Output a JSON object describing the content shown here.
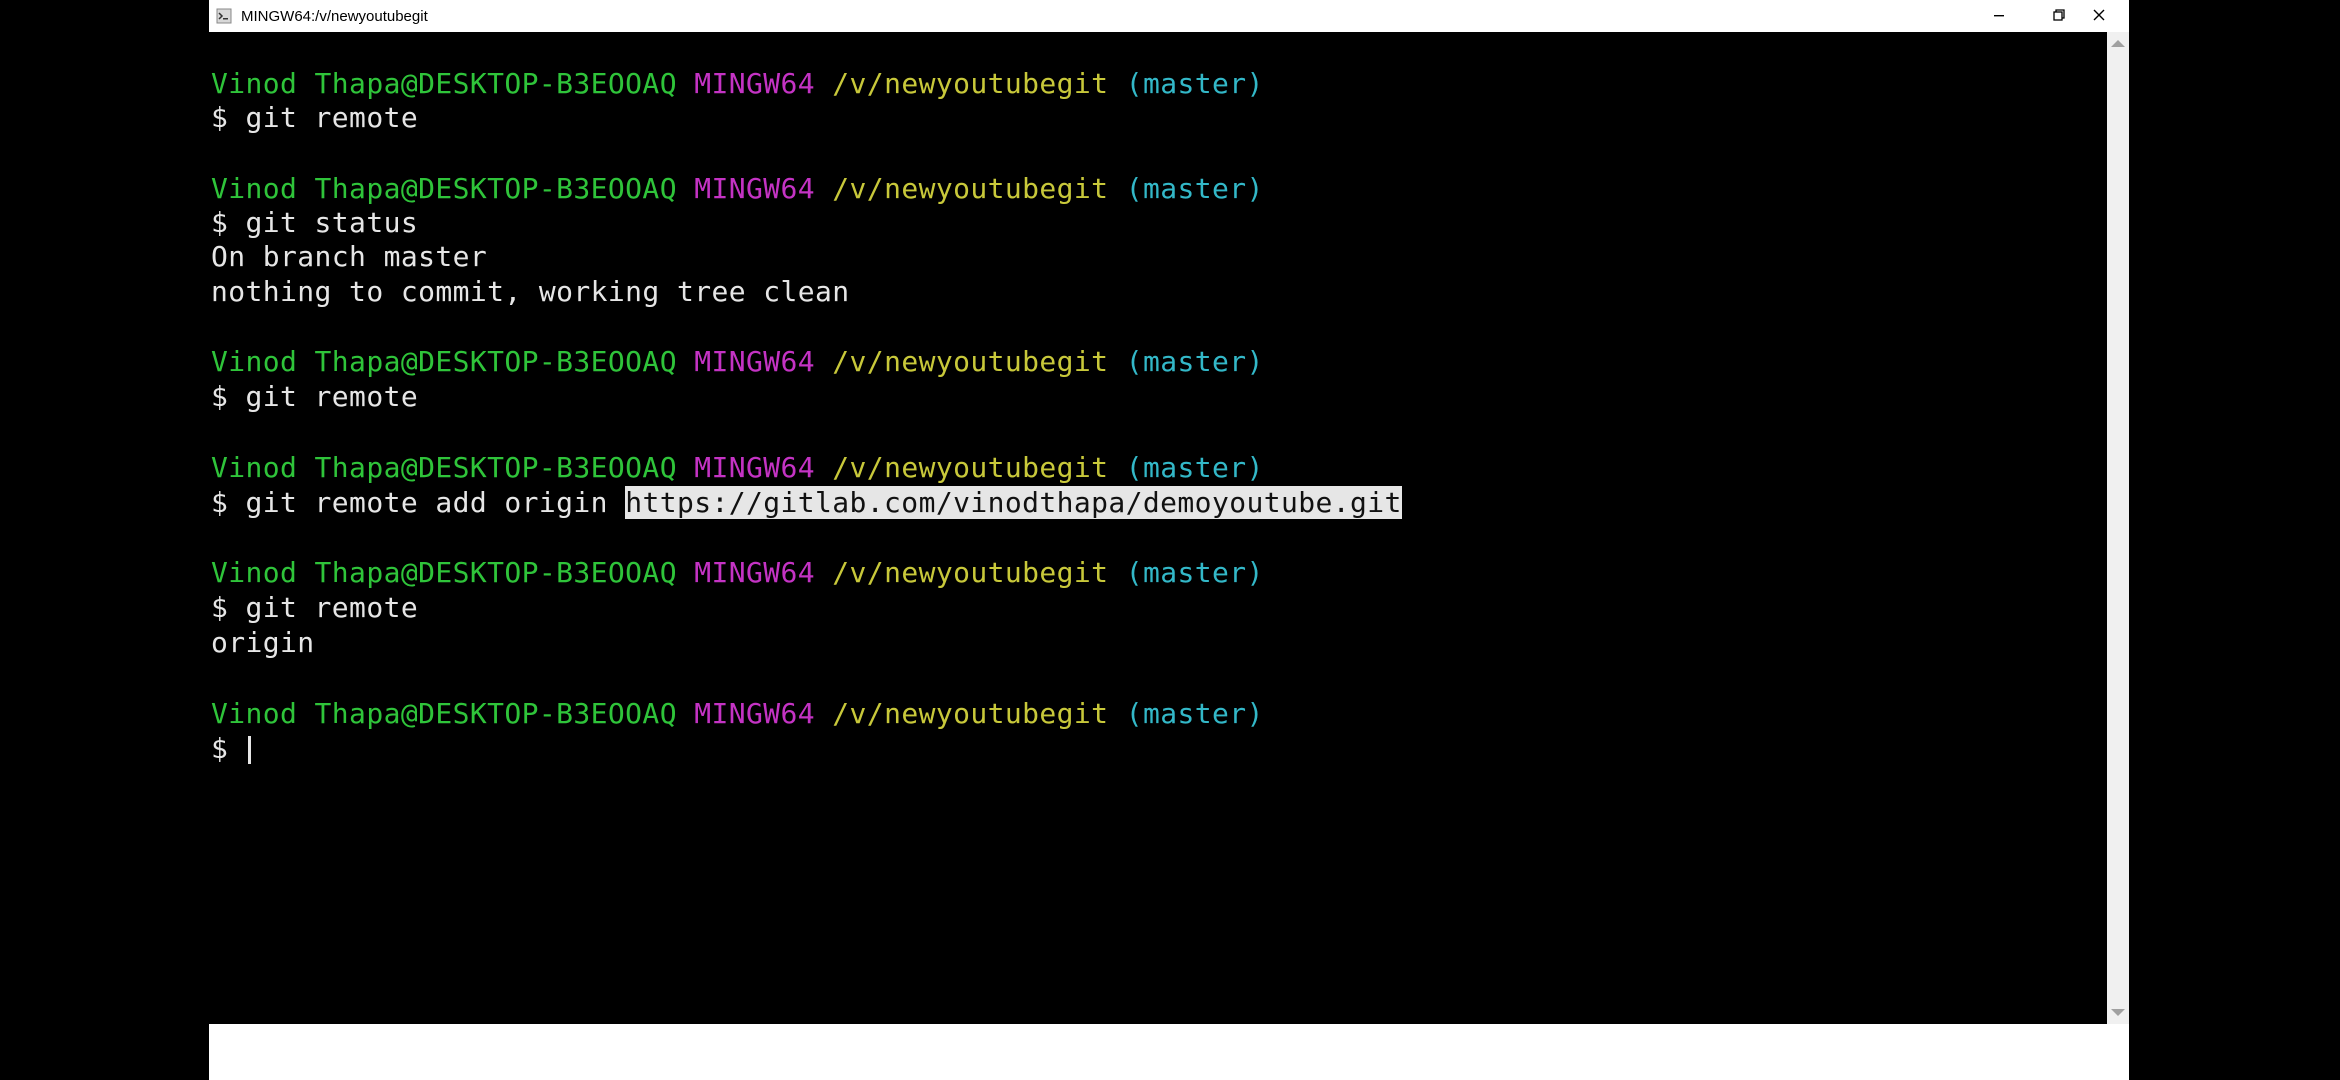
{
  "window": {
    "title": "MINGW64:/v/newyoutubegit",
    "controls": {
      "minimize": "minimize-icon",
      "maximize": "restore-icon",
      "close": "close-icon"
    }
  },
  "prompt": {
    "user": "Vinod Thapa@DESKTOP-B3EOOAQ",
    "system": "MINGW64",
    "path": "/v/newyoutubegit",
    "branch": "(master)"
  },
  "commands": {
    "c1": "$ git remote",
    "c2": "$ git status",
    "c3": "$ git remote",
    "c4_prefix": "$ git remote add origin ",
    "c4_url": "https://gitlab.com/vinodthapa/demoyoutube.git",
    "c5": "$ git remote",
    "c6": "$ "
  },
  "outputs": {
    "status_1": "On branch master",
    "status_2": "nothing to commit, working tree clean",
    "remote_1": "origin"
  },
  "colors": {
    "user": "#2fc43a",
    "system": "#c433c4",
    "path": "#c8c83a",
    "branch": "#33b8c8",
    "text": "#e6e6e6"
  }
}
